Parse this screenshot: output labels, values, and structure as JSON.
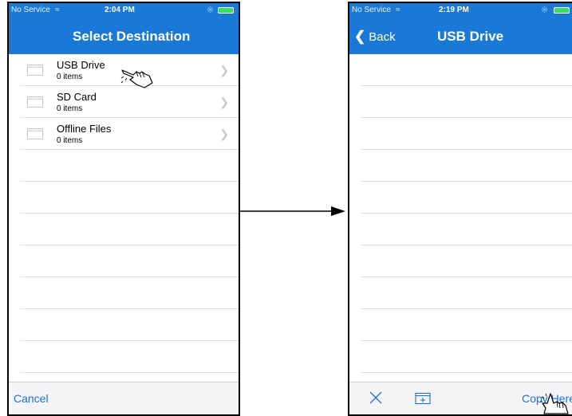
{
  "left_screen": {
    "status": {
      "carrier": "No Service",
      "time": "2:04 PM"
    },
    "nav_title": "Select Destination",
    "items": [
      {
        "name": "USB Drive",
        "count": "0 items"
      },
      {
        "name": "SD Card",
        "count": "0 items"
      },
      {
        "name": "Offline Files",
        "count": "0 items"
      }
    ],
    "cancel_label": "Cancel"
  },
  "right_screen": {
    "status": {
      "carrier": "No Service",
      "time": "2:19 PM"
    },
    "back_label": "Back",
    "nav_title": "USB Drive",
    "copy_here_label": "Copy Here"
  },
  "colors": {
    "bar_blue": "#1a78d7",
    "link_blue": "#1a6fd6",
    "separator": "#dcdcdc"
  },
  "icons": {
    "row_icon": "folder-icon",
    "row_chevron": "chevron-right-icon",
    "toolbar_left": "close-icon",
    "toolbar_middle": "new-folder-icon",
    "pointer": "hand-pointer-icon"
  }
}
